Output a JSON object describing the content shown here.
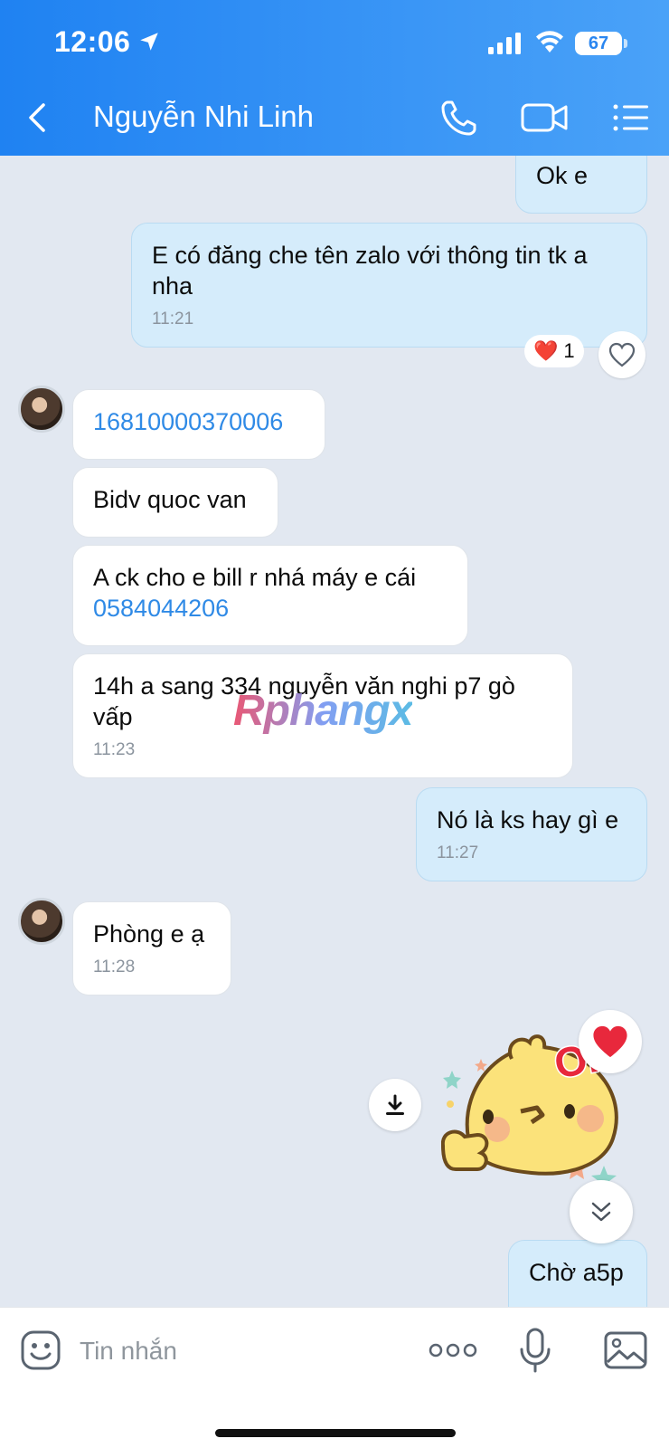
{
  "status_bar": {
    "time": "12:06",
    "battery": "67"
  },
  "header": {
    "title": "Nguyễn Nhi Linh"
  },
  "messages": [
    {
      "text": "Ok e"
    },
    {
      "text": "E có đăng che tên zalo với thông tin tk a nha",
      "time": "11:21"
    },
    {
      "text": "16810000370006"
    },
    {
      "text": "Bidv quoc van"
    },
    {
      "text_prefix": "A ck cho e bill r nhá máy e cái",
      "link": "0584044206"
    },
    {
      "text": "14h a sang 334 nguyễn văn nghi p7 gò vấp",
      "time": "11:23"
    },
    {
      "text": "Nó là ks hay gì e",
      "time": "11:27"
    },
    {
      "text": "Phòng e ạ",
      "time": "11:28"
    },
    {
      "text": "Chờ a5p"
    }
  ],
  "reaction": {
    "emoji": "❤️",
    "count": "1"
  },
  "sticker": {
    "label": "OK"
  },
  "watermark": "Rphangx",
  "input": {
    "placeholder": "Tin nhắn"
  },
  "colors": {
    "header": "#2a89f3",
    "outgoing_bubble": "#d5ecfb",
    "incoming_bubble": "#ffffff",
    "link": "#2f8ae6",
    "chat_bg": "#e2e8f1"
  },
  "icons": [
    "back-arrow-icon",
    "phone-icon",
    "video-camera-icon",
    "list-menu-icon",
    "heart-icon",
    "download-icon",
    "double-chevron-down-icon",
    "emoji-icon",
    "more-dots-icon",
    "microphone-icon",
    "image-icon"
  ]
}
